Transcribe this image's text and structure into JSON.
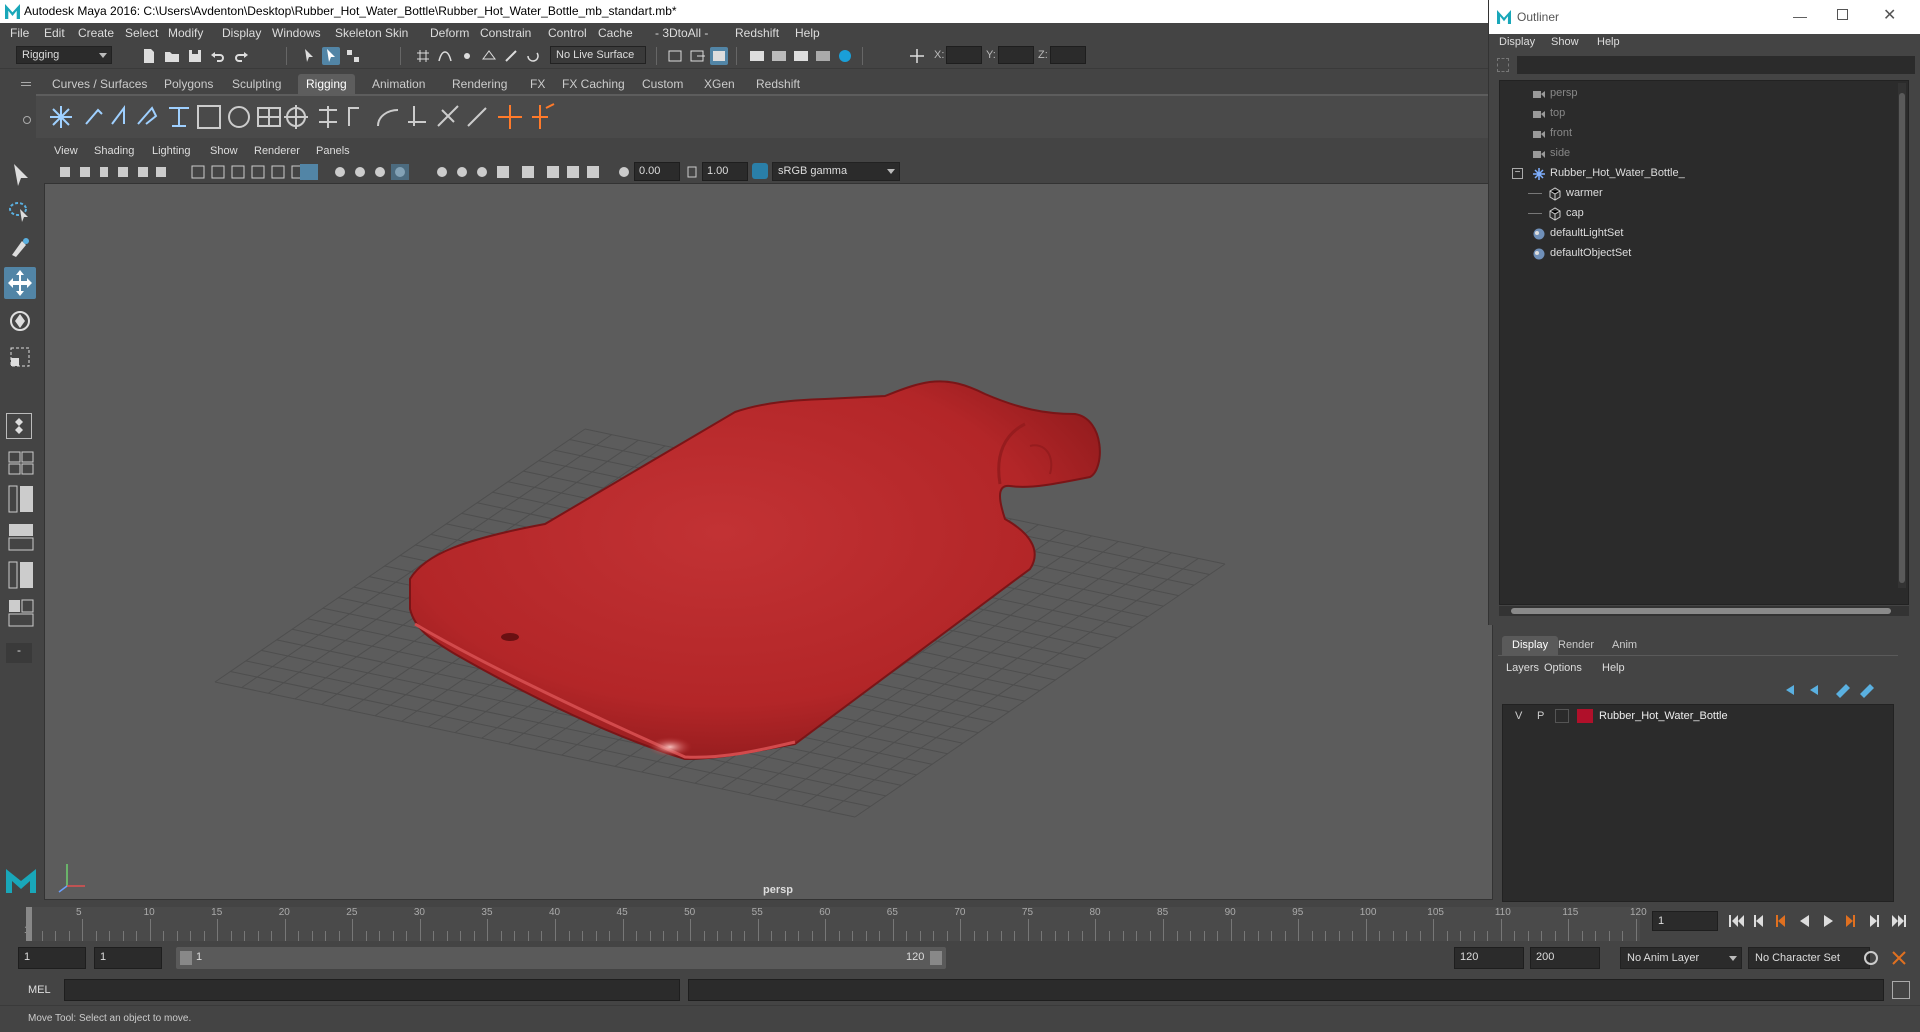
{
  "window": {
    "title": "Autodesk Maya 2016: C:\\Users\\Avdenton\\Desktop\\Rubber_Hot_Water_Bottle\\Rubber_Hot_Water_Bottle_mb_standart.mb*"
  },
  "menubar": [
    "File",
    "Edit",
    "Create",
    "Select",
    "Modify",
    "Display",
    "Windows",
    "Skeleton",
    "Skin",
    "Deform",
    "Constrain",
    "Control",
    "Cache",
    "- 3DtoAll -",
    "Redshift",
    "Help"
  ],
  "statusline": {
    "menuset": "Rigging",
    "live_surface": "No Live Surface",
    "x_label": "X:",
    "y_label": "Y:",
    "z_label": "Z:"
  },
  "shelf_tabs": [
    "Curves / Surfaces",
    "Polygons",
    "Sculpting",
    "Rigging",
    "Animation",
    "Rendering",
    "FX",
    "FX Caching",
    "Custom",
    "XGen",
    "Redshift"
  ],
  "shelf_active": "Rigging",
  "viewport_menu": [
    "View",
    "Shading",
    "Lighting",
    "Show",
    "Renderer",
    "Panels"
  ],
  "viewport_toolbar": {
    "exposure": "0.00",
    "gamma": "1.00",
    "color_space": "sRGB gamma"
  },
  "viewport": {
    "camera_label": "persp",
    "object_color": "#b7282a"
  },
  "outliner": {
    "title": "Outliner",
    "menu": [
      "Display",
      "Show",
      "Help"
    ],
    "items": [
      {
        "label": "persp",
        "dim": true
      },
      {
        "label": "top",
        "dim": true
      },
      {
        "label": "front",
        "dim": true
      },
      {
        "label": "side",
        "dim": true
      },
      {
        "label": "Rubber_Hot_Water_Bottle_",
        "dim": false
      },
      {
        "label": "warmer",
        "dim": false
      },
      {
        "label": "cap",
        "dim": false
      },
      {
        "label": "defaultLightSet",
        "dim": false
      },
      {
        "label": "defaultObjectSet",
        "dim": false
      }
    ]
  },
  "layer_editor": {
    "tabs": [
      "Display",
      "Render",
      "Anim"
    ],
    "active_tab": "Display",
    "menu": [
      "Layers",
      "Options",
      "Help"
    ],
    "layer": {
      "v": "V",
      "p": "P",
      "name": "Rubber_Hot_Water_Bottle",
      "color": "#b0102a"
    }
  },
  "timeline": {
    "ticks": [
      "1",
      "5",
      "10",
      "15",
      "20",
      "25",
      "30",
      "35",
      "40",
      "45",
      "50",
      "55",
      "60",
      "65",
      "70",
      "75",
      "80",
      "85",
      "90",
      "95",
      "100",
      "105",
      "110",
      "115",
      "120"
    ],
    "current_frame": "1"
  },
  "range": {
    "start": "1",
    "playback_start": "1",
    "slider_start": "1",
    "slider_end": "120",
    "playback_end": "120",
    "end": "200",
    "anim_layer": "No Anim Layer",
    "char_set": "No Character Set"
  },
  "cmdline": {
    "label": "MEL"
  },
  "helpline": {
    "text": "Move Tool: Select an object to move."
  }
}
